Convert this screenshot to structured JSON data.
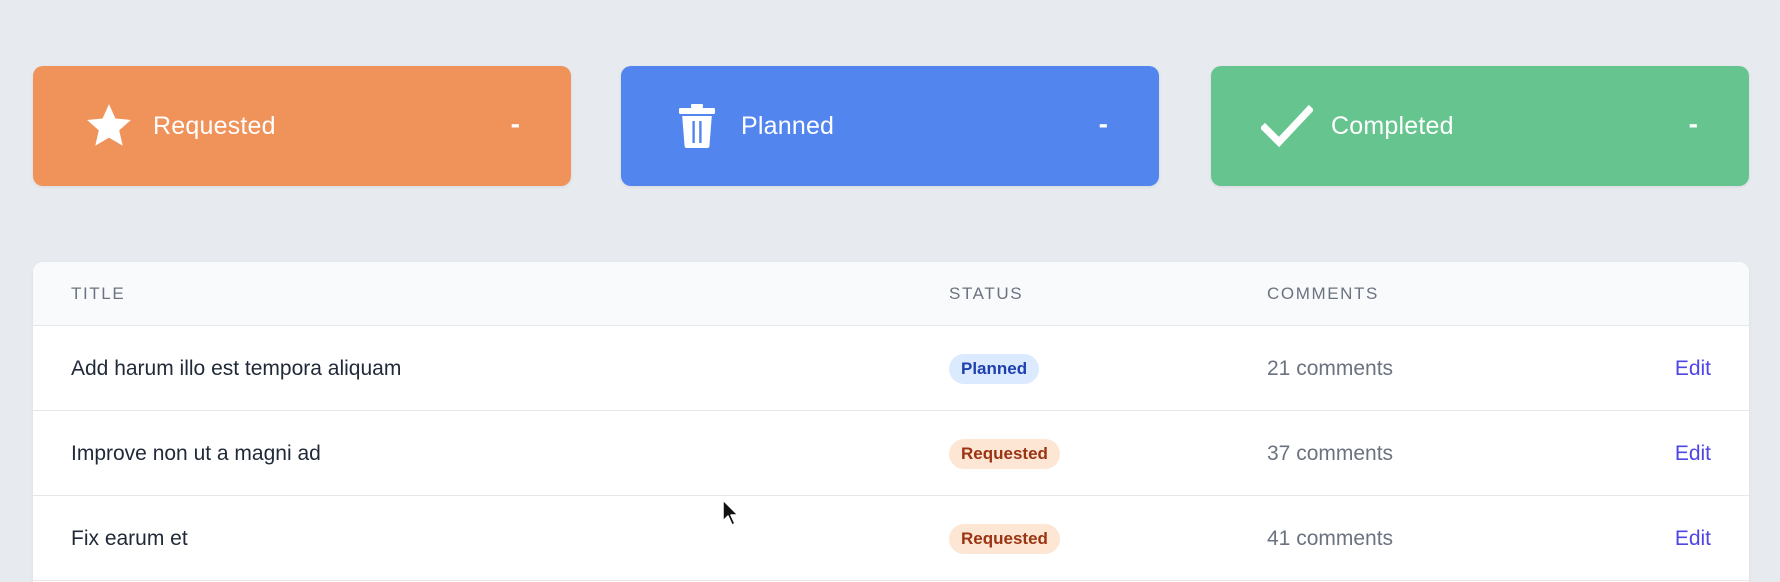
{
  "colors": {
    "requested_card": "#ef935a",
    "planned_card": "#5285ee",
    "completed_card": "#66c58f"
  },
  "cards": [
    {
      "icon": "star-icon",
      "label": "Requested",
      "count": "-"
    },
    {
      "icon": "trash-icon",
      "label": "Planned",
      "count": "-"
    },
    {
      "icon": "check-icon",
      "label": "Completed",
      "count": "-"
    }
  ],
  "table": {
    "headers": {
      "title": "TITLE",
      "status": "STATUS",
      "comments": "COMMENTS"
    },
    "rows": [
      {
        "title": "Add harum illo est tempora aliquam",
        "status": "Planned",
        "comments": "21 comments",
        "action": "Edit"
      },
      {
        "title": "Improve non ut a magni ad",
        "status": "Requested",
        "comments": "37 comments",
        "action": "Edit"
      },
      {
        "title": "Fix earum et",
        "status": "Requested",
        "comments": "41 comments",
        "action": "Edit"
      }
    ]
  }
}
